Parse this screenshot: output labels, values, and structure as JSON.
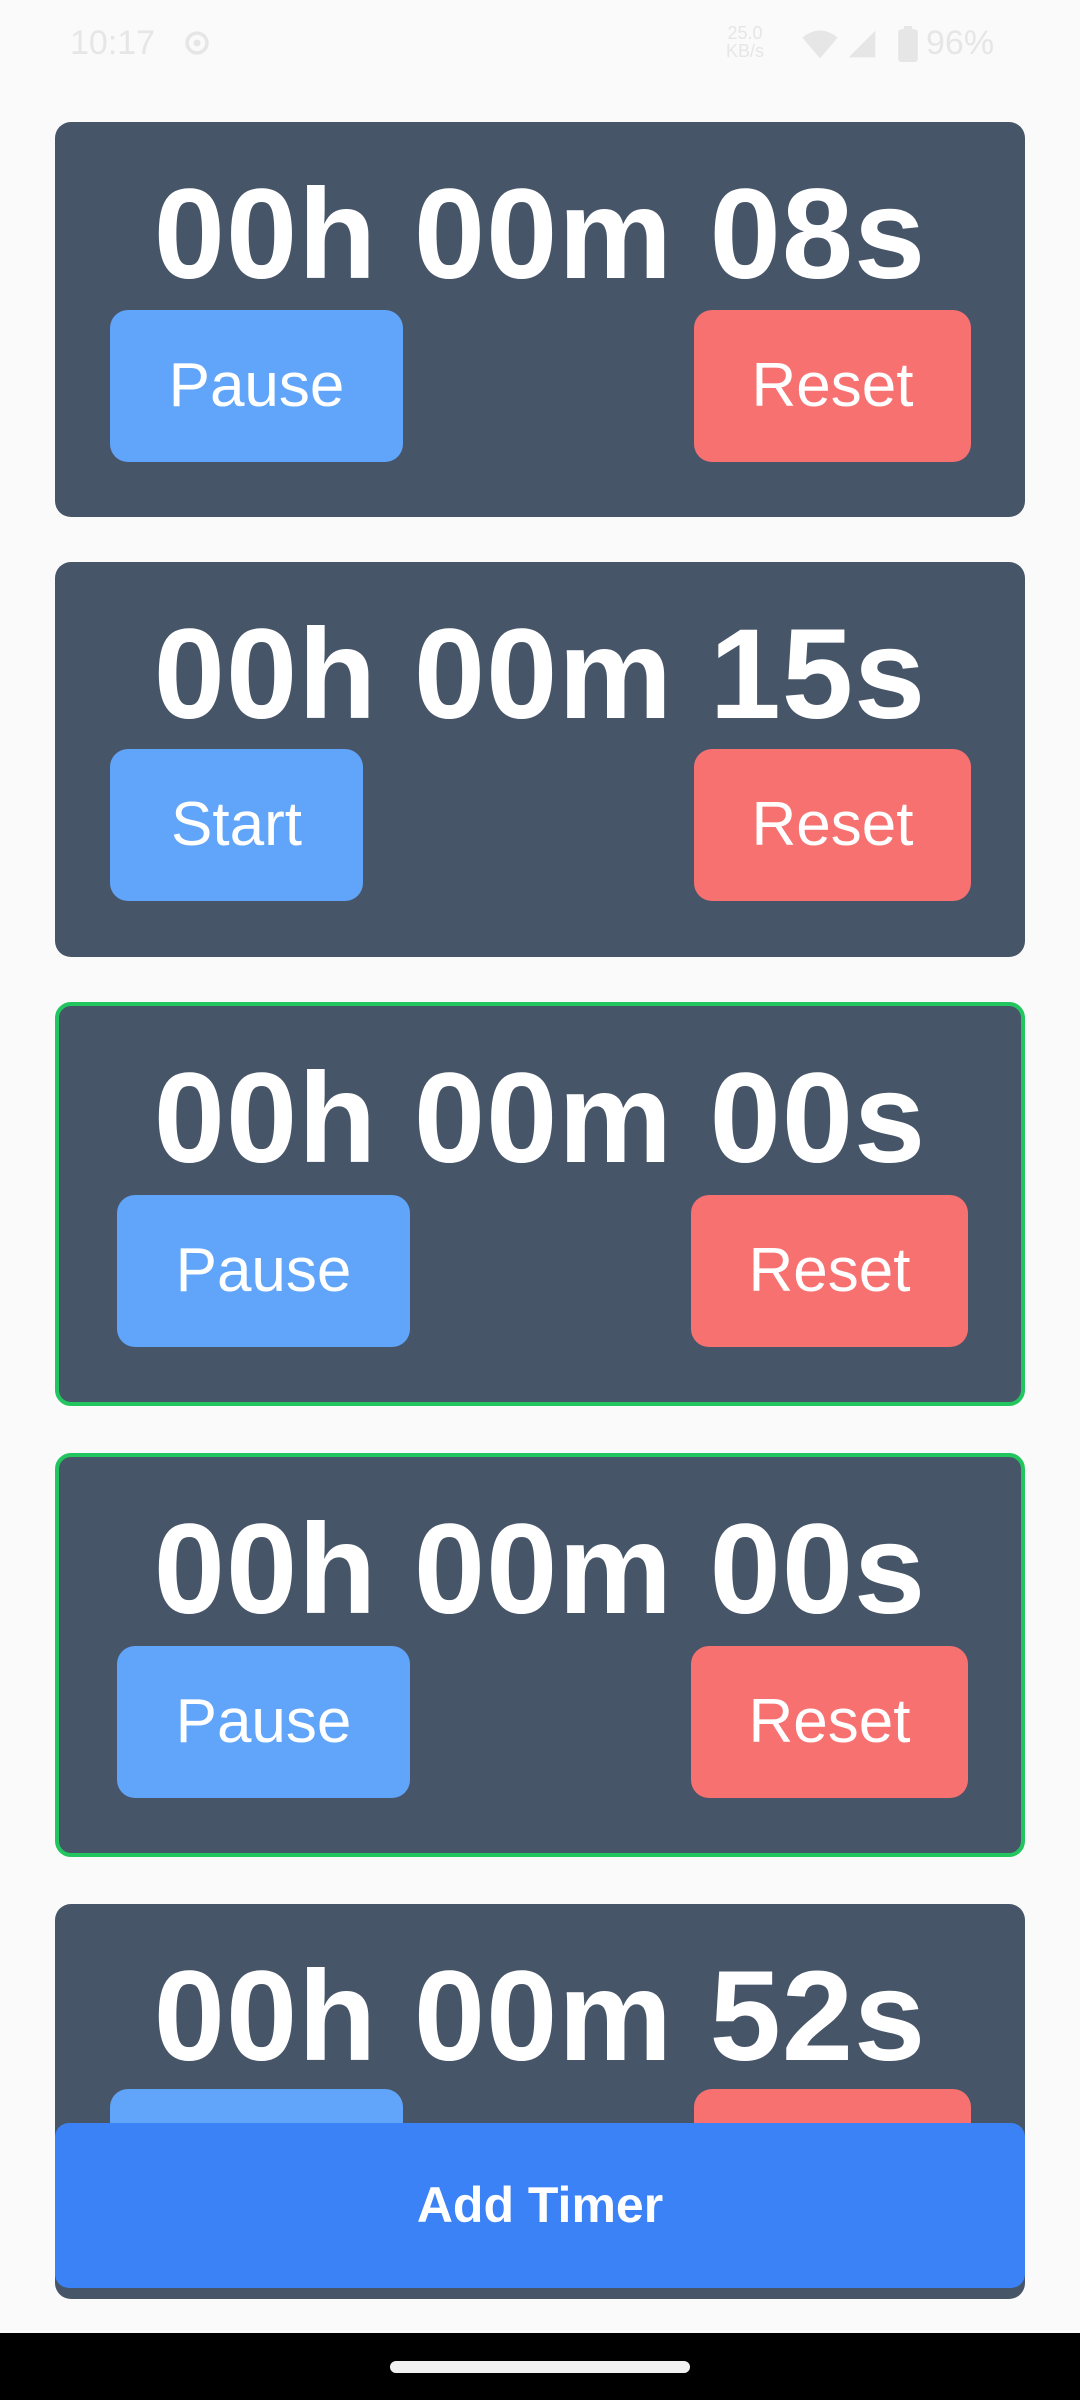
{
  "status_bar": {
    "time": "10:17",
    "net_speed": "25.0",
    "net_unit": "KB/s",
    "battery": "96%",
    "icons": [
      "settings-icon",
      "wifi-icon",
      "signal-icon",
      "battery-icon"
    ]
  },
  "timers": [
    {
      "display": "00h 00m 08s",
      "primary_label": "Pause",
      "reset_label": "Reset",
      "active": false
    },
    {
      "display": "00h 00m 15s",
      "primary_label": "Start",
      "reset_label": "Reset",
      "active": false
    },
    {
      "display": "00h 00m 00s",
      "primary_label": "Pause",
      "reset_label": "Reset",
      "active": true
    },
    {
      "display": "00h 00m 00s",
      "primary_label": "Pause",
      "reset_label": "Reset",
      "active": true
    },
    {
      "display": "00h 00m 52s",
      "primary_label": "",
      "reset_label": "",
      "active": false
    }
  ],
  "add_timer_label": "Add Timer",
  "colors": {
    "card_bg": "#475569",
    "primary_button": "#60a5fa",
    "reset_button": "#f87171",
    "active_border": "#22c55e",
    "add_button": "#3b82f6"
  }
}
